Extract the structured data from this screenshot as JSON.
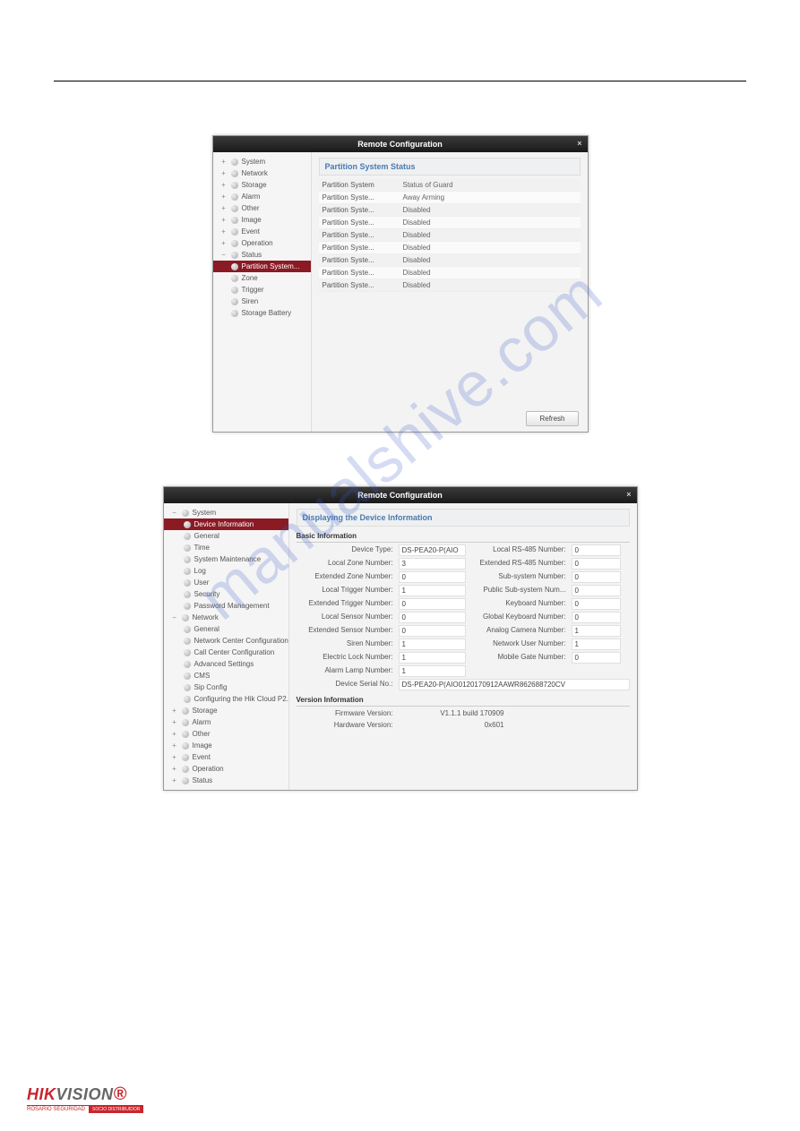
{
  "win1": {
    "title": "Remote Configuration",
    "panel_title": "Partition System Status",
    "refresh": "Refresh",
    "sidebar": [
      {
        "exp": "+",
        "label": "System"
      },
      {
        "exp": "+",
        "label": "Network"
      },
      {
        "exp": "+",
        "label": "Storage"
      },
      {
        "exp": "+",
        "label": "Alarm"
      },
      {
        "exp": "+",
        "label": "Other"
      },
      {
        "exp": "+",
        "label": "Image"
      },
      {
        "exp": "+",
        "label": "Event"
      },
      {
        "exp": "+",
        "label": "Operation"
      },
      {
        "exp": "−",
        "label": "Status"
      }
    ],
    "status_children": [
      {
        "label": "Partition System...",
        "selected": true
      },
      {
        "label": "Zone"
      },
      {
        "label": "Trigger"
      },
      {
        "label": "Siren"
      },
      {
        "label": "Storage Battery"
      }
    ],
    "rows": [
      {
        "c1": "Partition System",
        "c2": "Status of Guard"
      },
      {
        "c1": "Partition Syste...",
        "c2": "Away Arming"
      },
      {
        "c1": "Partition Syste...",
        "c2": "Disabled"
      },
      {
        "c1": "Partition Syste...",
        "c2": "Disabled"
      },
      {
        "c1": "Partition Syste...",
        "c2": "Disabled"
      },
      {
        "c1": "Partition Syste...",
        "c2": "Disabled"
      },
      {
        "c1": "Partition Syste...",
        "c2": "Disabled"
      },
      {
        "c1": "Partition Syste...",
        "c2": "Disabled"
      },
      {
        "c1": "Partition Syste...",
        "c2": "Disabled"
      }
    ]
  },
  "win2": {
    "title": "Remote Configuration",
    "panel_title": "Displaying the Device Information",
    "basic_label": "Basic Information",
    "version_label": "Version Information",
    "sidebar_system": {
      "exp": "−",
      "label": "System"
    },
    "system_children": [
      {
        "label": "Device Information",
        "selected": true
      },
      {
        "label": "General"
      },
      {
        "label": "Time"
      },
      {
        "label": "System Maintenance"
      },
      {
        "label": "Log"
      },
      {
        "label": "User"
      },
      {
        "label": "Security"
      },
      {
        "label": "Password Management"
      }
    ],
    "sidebar_network": {
      "exp": "−",
      "label": "Network"
    },
    "network_children": [
      {
        "label": "General"
      },
      {
        "label": "Network Center Configuration"
      },
      {
        "label": "Call Center Configuration"
      },
      {
        "label": "Advanced Settings"
      },
      {
        "label": "CMS"
      },
      {
        "label": "Sip Config"
      },
      {
        "label": "Configuring the Hik Cloud P2..."
      }
    ],
    "sidebar_rest": [
      {
        "exp": "+",
        "label": "Storage"
      },
      {
        "exp": "+",
        "label": "Alarm"
      },
      {
        "exp": "+",
        "label": "Other"
      },
      {
        "exp": "+",
        "label": "Image"
      },
      {
        "exp": "+",
        "label": "Event"
      },
      {
        "exp": "+",
        "label": "Operation"
      },
      {
        "exp": "+",
        "label": "Status"
      }
    ],
    "info_left": [
      {
        "l": "Device Type:",
        "v": "DS-PEA20-P(AIO"
      },
      {
        "l": "Local Zone Number:",
        "v": "3"
      },
      {
        "l": "Extended Zone Number:",
        "v": "0"
      },
      {
        "l": "Local Trigger Number:",
        "v": "1"
      },
      {
        "l": "Extended Trigger Number:",
        "v": "0"
      },
      {
        "l": "Local Sensor Number:",
        "v": "0"
      },
      {
        "l": "Extended Sensor Number:",
        "v": "0"
      },
      {
        "l": "Siren Number:",
        "v": "1"
      },
      {
        "l": "Electric Lock Number:",
        "v": "1"
      },
      {
        "l": "Alarm Lamp Number:",
        "v": "1"
      }
    ],
    "info_right": [
      {
        "l": "Local RS-485 Number:",
        "v": "0"
      },
      {
        "l": "Extended RS-485 Number:",
        "v": "0"
      },
      {
        "l": "Sub-system Number:",
        "v": "0"
      },
      {
        "l": "Public Sub-system Num...",
        "v": "0"
      },
      {
        "l": "Keyboard Number:",
        "v": "0"
      },
      {
        "l": "Global Keyboard Number:",
        "v": "0"
      },
      {
        "l": "Analog Camera Number:",
        "v": "1"
      },
      {
        "l": "Network User Number:",
        "v": "1"
      },
      {
        "l": "Mobile Gate Number:",
        "v": "0"
      }
    ],
    "serial": {
      "l": "Device Serial No.:",
      "v": "DS-PEA20-P(AIO0120170912AAWR862688720CV"
    },
    "version": [
      {
        "l": "Firmware Version:",
        "v": "V1.1.1 build 170909"
      },
      {
        "l": "Hardware Version:",
        "v": "0x601"
      }
    ]
  },
  "watermark": "manualshive.com",
  "logo": {
    "hik": "HIK",
    "vision": "VISION",
    "sub1": "ROSARIO SEGURIDAD",
    "sub2": "SOCIO DISTRIBUIDOR"
  }
}
